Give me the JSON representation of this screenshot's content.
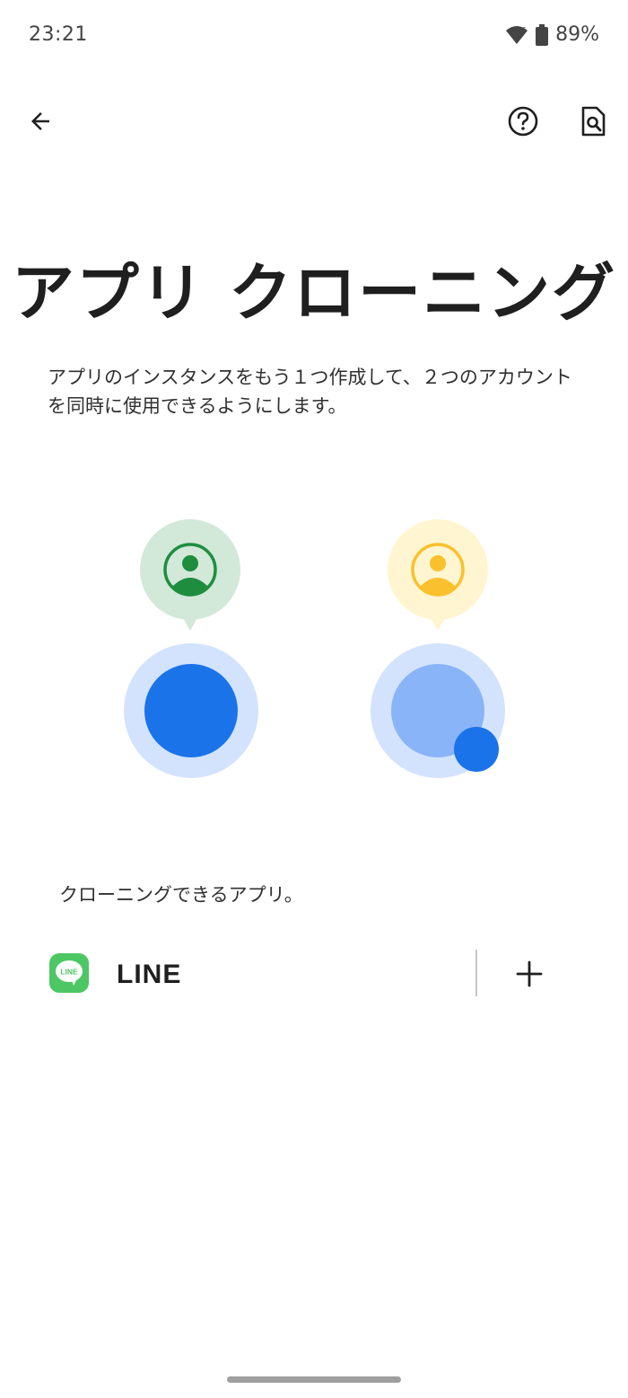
{
  "status_bar": {
    "time": "23:21",
    "battery": "89%"
  },
  "app_bar": {
    "back_icon": "arrow-back-icon",
    "help_icon": "help-icon",
    "search_doc_icon": "search-document-icon"
  },
  "page": {
    "title": "アプリ クローニング",
    "description": "アプリのインスタンスをもう１つ作成して、２つのアカウントを同時に使用できるようにします。"
  },
  "section": {
    "header": "クローニングできるアプリ。"
  },
  "apps": [
    {
      "name": "LINE",
      "icon_text": "LINE",
      "icon_color": "#4cc764"
    }
  ],
  "colors": {
    "primary_blue": "#1a73e8",
    "light_blue": "#d3e3fd",
    "mid_blue": "#8ab4f8",
    "green_bubble": "#d2e8d9",
    "green": "#1e8e3e",
    "yellow_bubble": "#fff6d1",
    "yellow": "#fbc02d"
  }
}
